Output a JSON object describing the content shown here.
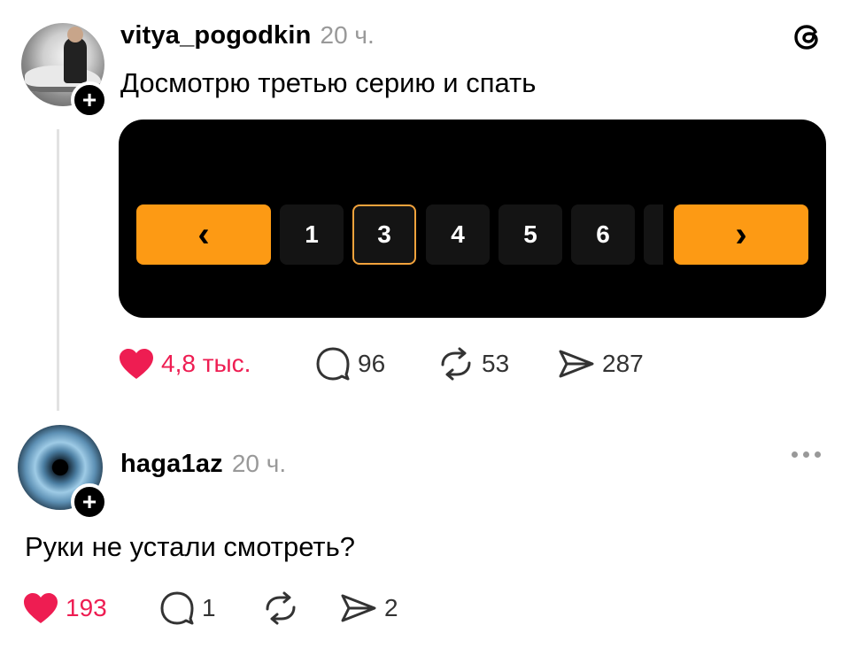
{
  "post": {
    "username": "vitya_pogodkin",
    "time": "20 ч.",
    "text": "Досмотрю третью серию и спать",
    "pagination": {
      "prev": "‹",
      "next": "›",
      "pages": [
        "1",
        "3",
        "4",
        "5",
        "6"
      ],
      "current": "3"
    },
    "stats": {
      "likes": "4,8 тыс.",
      "comments": "96",
      "reposts": "53",
      "shares": "287"
    }
  },
  "reply": {
    "username": "haga1az",
    "time": "20 ч.",
    "text": "Руки не устали смотреть?",
    "stats": {
      "likes": "193",
      "comments": "1",
      "shares": "2"
    }
  },
  "colors": {
    "like": "#ee1d52",
    "accent": "#fd9a14",
    "muted": "#999999"
  },
  "icons": [
    "threads-logo-icon",
    "heart-icon",
    "comment-icon",
    "repost-icon",
    "share-icon",
    "more-icon",
    "follow-plus-icon"
  ]
}
